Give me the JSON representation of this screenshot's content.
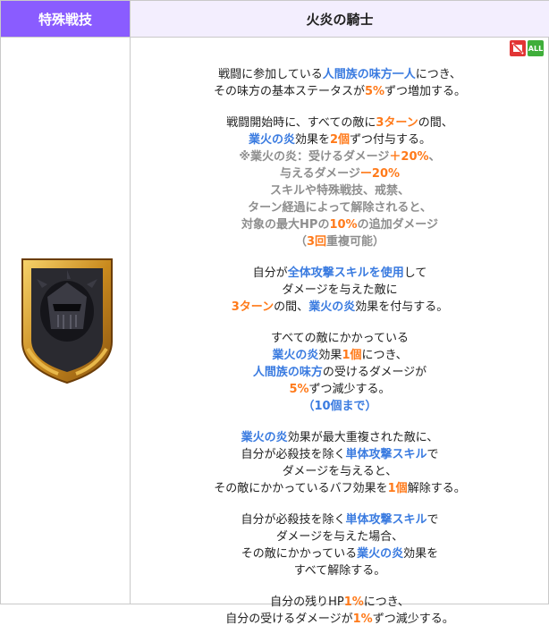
{
  "header": {
    "left_label": "特殊戦技",
    "right_label": "火炎の騎士"
  },
  "icons": {
    "all_label": "ALL"
  },
  "paragraphs": [
    [
      [
        {
          "t": "戦闘に参加している",
          "s": "n"
        },
        {
          "t": "人間族の味方一人",
          "s": "b"
        },
        {
          "t": "につき、",
          "s": "n"
        }
      ],
      [
        {
          "t": "その味方の基本ステータスが",
          "s": "n"
        },
        {
          "t": "5%",
          "s": "o"
        },
        {
          "t": "ずつ増加する。",
          "s": "n"
        }
      ]
    ],
    [
      [
        {
          "t": "戦闘開始時に、すべての敵に",
          "s": "n"
        },
        {
          "t": "3ターン",
          "s": "o"
        },
        {
          "t": "の間、",
          "s": "n"
        }
      ],
      [
        {
          "t": "業火の炎",
          "s": "b"
        },
        {
          "t": "効果を",
          "s": "n"
        },
        {
          "t": "2個",
          "s": "o"
        },
        {
          "t": "ずつ付与する。",
          "s": "n"
        }
      ],
      [
        {
          "t": "※業火の炎：受けるダメージ",
          "s": "g"
        },
        {
          "t": "＋20%",
          "s": "o"
        },
        {
          "t": "、",
          "s": "g"
        }
      ],
      [
        {
          "t": "与えるダメージ",
          "s": "g"
        },
        {
          "t": "ー20%",
          "s": "o"
        }
      ],
      [
        {
          "t": "スキルや特殊戦技、戒禁、",
          "s": "g"
        }
      ],
      [
        {
          "t": "ターン経過によって解除されると、",
          "s": "g"
        }
      ],
      [
        {
          "t": "対象の最大HPの",
          "s": "g"
        },
        {
          "t": "10%",
          "s": "o"
        },
        {
          "t": "の追加ダメージ",
          "s": "g"
        }
      ],
      [
        {
          "t": "（",
          "s": "g"
        },
        {
          "t": "3回",
          "s": "o"
        },
        {
          "t": "重複可能）",
          "s": "g"
        }
      ]
    ],
    [
      [
        {
          "t": "自分が",
          "s": "n"
        },
        {
          "t": "全体攻撃スキルを使用",
          "s": "b"
        },
        {
          "t": "して",
          "s": "n"
        }
      ],
      [
        {
          "t": "ダメージを与えた敵に",
          "s": "n"
        }
      ],
      [
        {
          "t": "3ターン",
          "s": "o"
        },
        {
          "t": "の間、",
          "s": "n"
        },
        {
          "t": "業火の炎",
          "s": "b"
        },
        {
          "t": "効果を付与する。",
          "s": "n"
        }
      ]
    ],
    [
      [
        {
          "t": "すべての敵にかかっている",
          "s": "n"
        }
      ],
      [
        {
          "t": "業火の炎",
          "s": "b"
        },
        {
          "t": "効果",
          "s": "n"
        },
        {
          "t": "1個",
          "s": "o"
        },
        {
          "t": "につき、",
          "s": "n"
        }
      ],
      [
        {
          "t": "人間族の味方",
          "s": "b"
        },
        {
          "t": "の受けるダメージが",
          "s": "n"
        }
      ],
      [
        {
          "t": "5%",
          "s": "o"
        },
        {
          "t": "ずつ減少する。",
          "s": "n"
        }
      ],
      [
        {
          "t": "（10個まで）",
          "s": "b"
        }
      ]
    ],
    [
      [
        {
          "t": "業火の炎",
          "s": "b"
        },
        {
          "t": "効果が最大重複された敵に、",
          "s": "n"
        }
      ],
      [
        {
          "t": "自分が必殺技を除く",
          "s": "n"
        },
        {
          "t": "単体攻撃スキル",
          "s": "b"
        },
        {
          "t": "で",
          "s": "n"
        }
      ],
      [
        {
          "t": "ダメージを与えると、",
          "s": "n"
        }
      ],
      [
        {
          "t": "その敵にかかっているバフ効果を",
          "s": "n"
        },
        {
          "t": "1個",
          "s": "o"
        },
        {
          "t": "解除する。",
          "s": "n"
        }
      ]
    ],
    [
      [
        {
          "t": "自分が必殺技を除く",
          "s": "n"
        },
        {
          "t": "単体攻撃スキル",
          "s": "b"
        },
        {
          "t": "で",
          "s": "n"
        }
      ],
      [
        {
          "t": "ダメージを与えた場合、",
          "s": "n"
        }
      ],
      [
        {
          "t": "その敵にかかっている",
          "s": "n"
        },
        {
          "t": "業火の炎",
          "s": "b"
        },
        {
          "t": "効果を",
          "s": "n"
        }
      ],
      [
        {
          "t": "すべて解除する。",
          "s": "n"
        }
      ]
    ],
    [
      [
        {
          "t": "自分の残りHP",
          "s": "n"
        },
        {
          "t": "1%",
          "s": "o"
        },
        {
          "t": "につき、",
          "s": "n"
        }
      ],
      [
        {
          "t": "自分の受けるダメージが",
          "s": "n"
        },
        {
          "t": "1%",
          "s": "o"
        },
        {
          "t": "ずつ減少する。",
          "s": "n"
        }
      ]
    ]
  ],
  "colors": {
    "header_purple": "#8a5cff",
    "header_light": "#f3eefe",
    "blue": "#3a7be0",
    "orange": "#ff7a1a",
    "gray": "#8e8e8e"
  }
}
